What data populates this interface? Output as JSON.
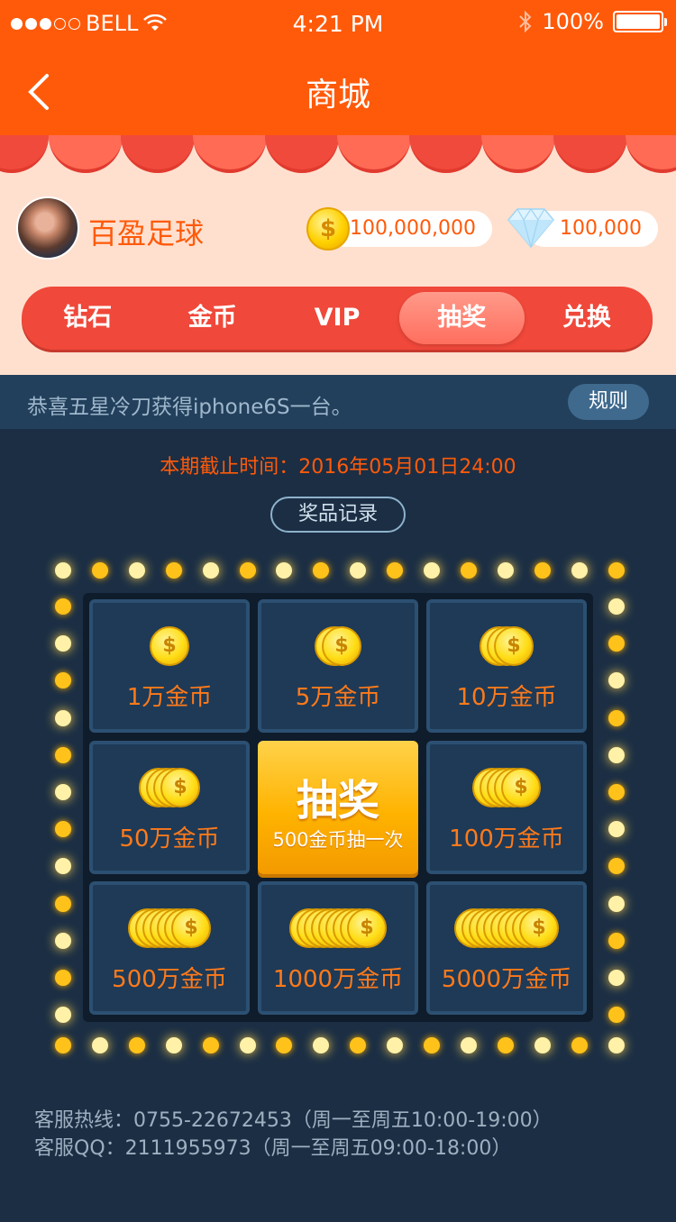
{
  "status_bar": {
    "carrier": "BELL",
    "time": "4:21 PM",
    "battery": "100%"
  },
  "nav": {
    "title": "商城",
    "back_icon": "chevron-left-icon"
  },
  "profile": {
    "username": "百盈足球",
    "coins": "100,000,000",
    "gems": "100,000"
  },
  "tabs": [
    {
      "label": "钻石"
    },
    {
      "label": "金币"
    },
    {
      "label": "VIP"
    },
    {
      "label": "抽奖",
      "active": true
    },
    {
      "label": "兑换"
    }
  ],
  "notice": {
    "text": "恭喜五星冷刀获得iphone6S一台。",
    "rules": "规则"
  },
  "deadline": "本期截止时间：2016年05月01日24:00",
  "records_button": "奖品记录",
  "prizes": [
    {
      "label": "1万金币",
      "coins": 1
    },
    {
      "label": "5万金币",
      "coins": 2
    },
    {
      "label": "10万金币",
      "coins": 3
    },
    {
      "label": "50万金币",
      "coins": 4
    },
    {
      "label": "100万金币",
      "coins": 5
    },
    {
      "label": "500万金币",
      "coins": 7
    },
    {
      "label": "1000万金币",
      "coins": 9
    },
    {
      "label": "5000万金币",
      "coins": 10
    }
  ],
  "draw": {
    "title": "抽奖",
    "subtitle": "500金币抽一次"
  },
  "footer": {
    "hotline": "客服热线：0755-22672453（周一至周五10:00-19:00）",
    "qq": "客服QQ：2111955973（周一至周五09:00-18:00）"
  },
  "colors": {
    "primary": "#ff5a0a",
    "panel": "#1b2e44",
    "tab_bar": "#f0483a",
    "gold": "#ffc21a"
  }
}
